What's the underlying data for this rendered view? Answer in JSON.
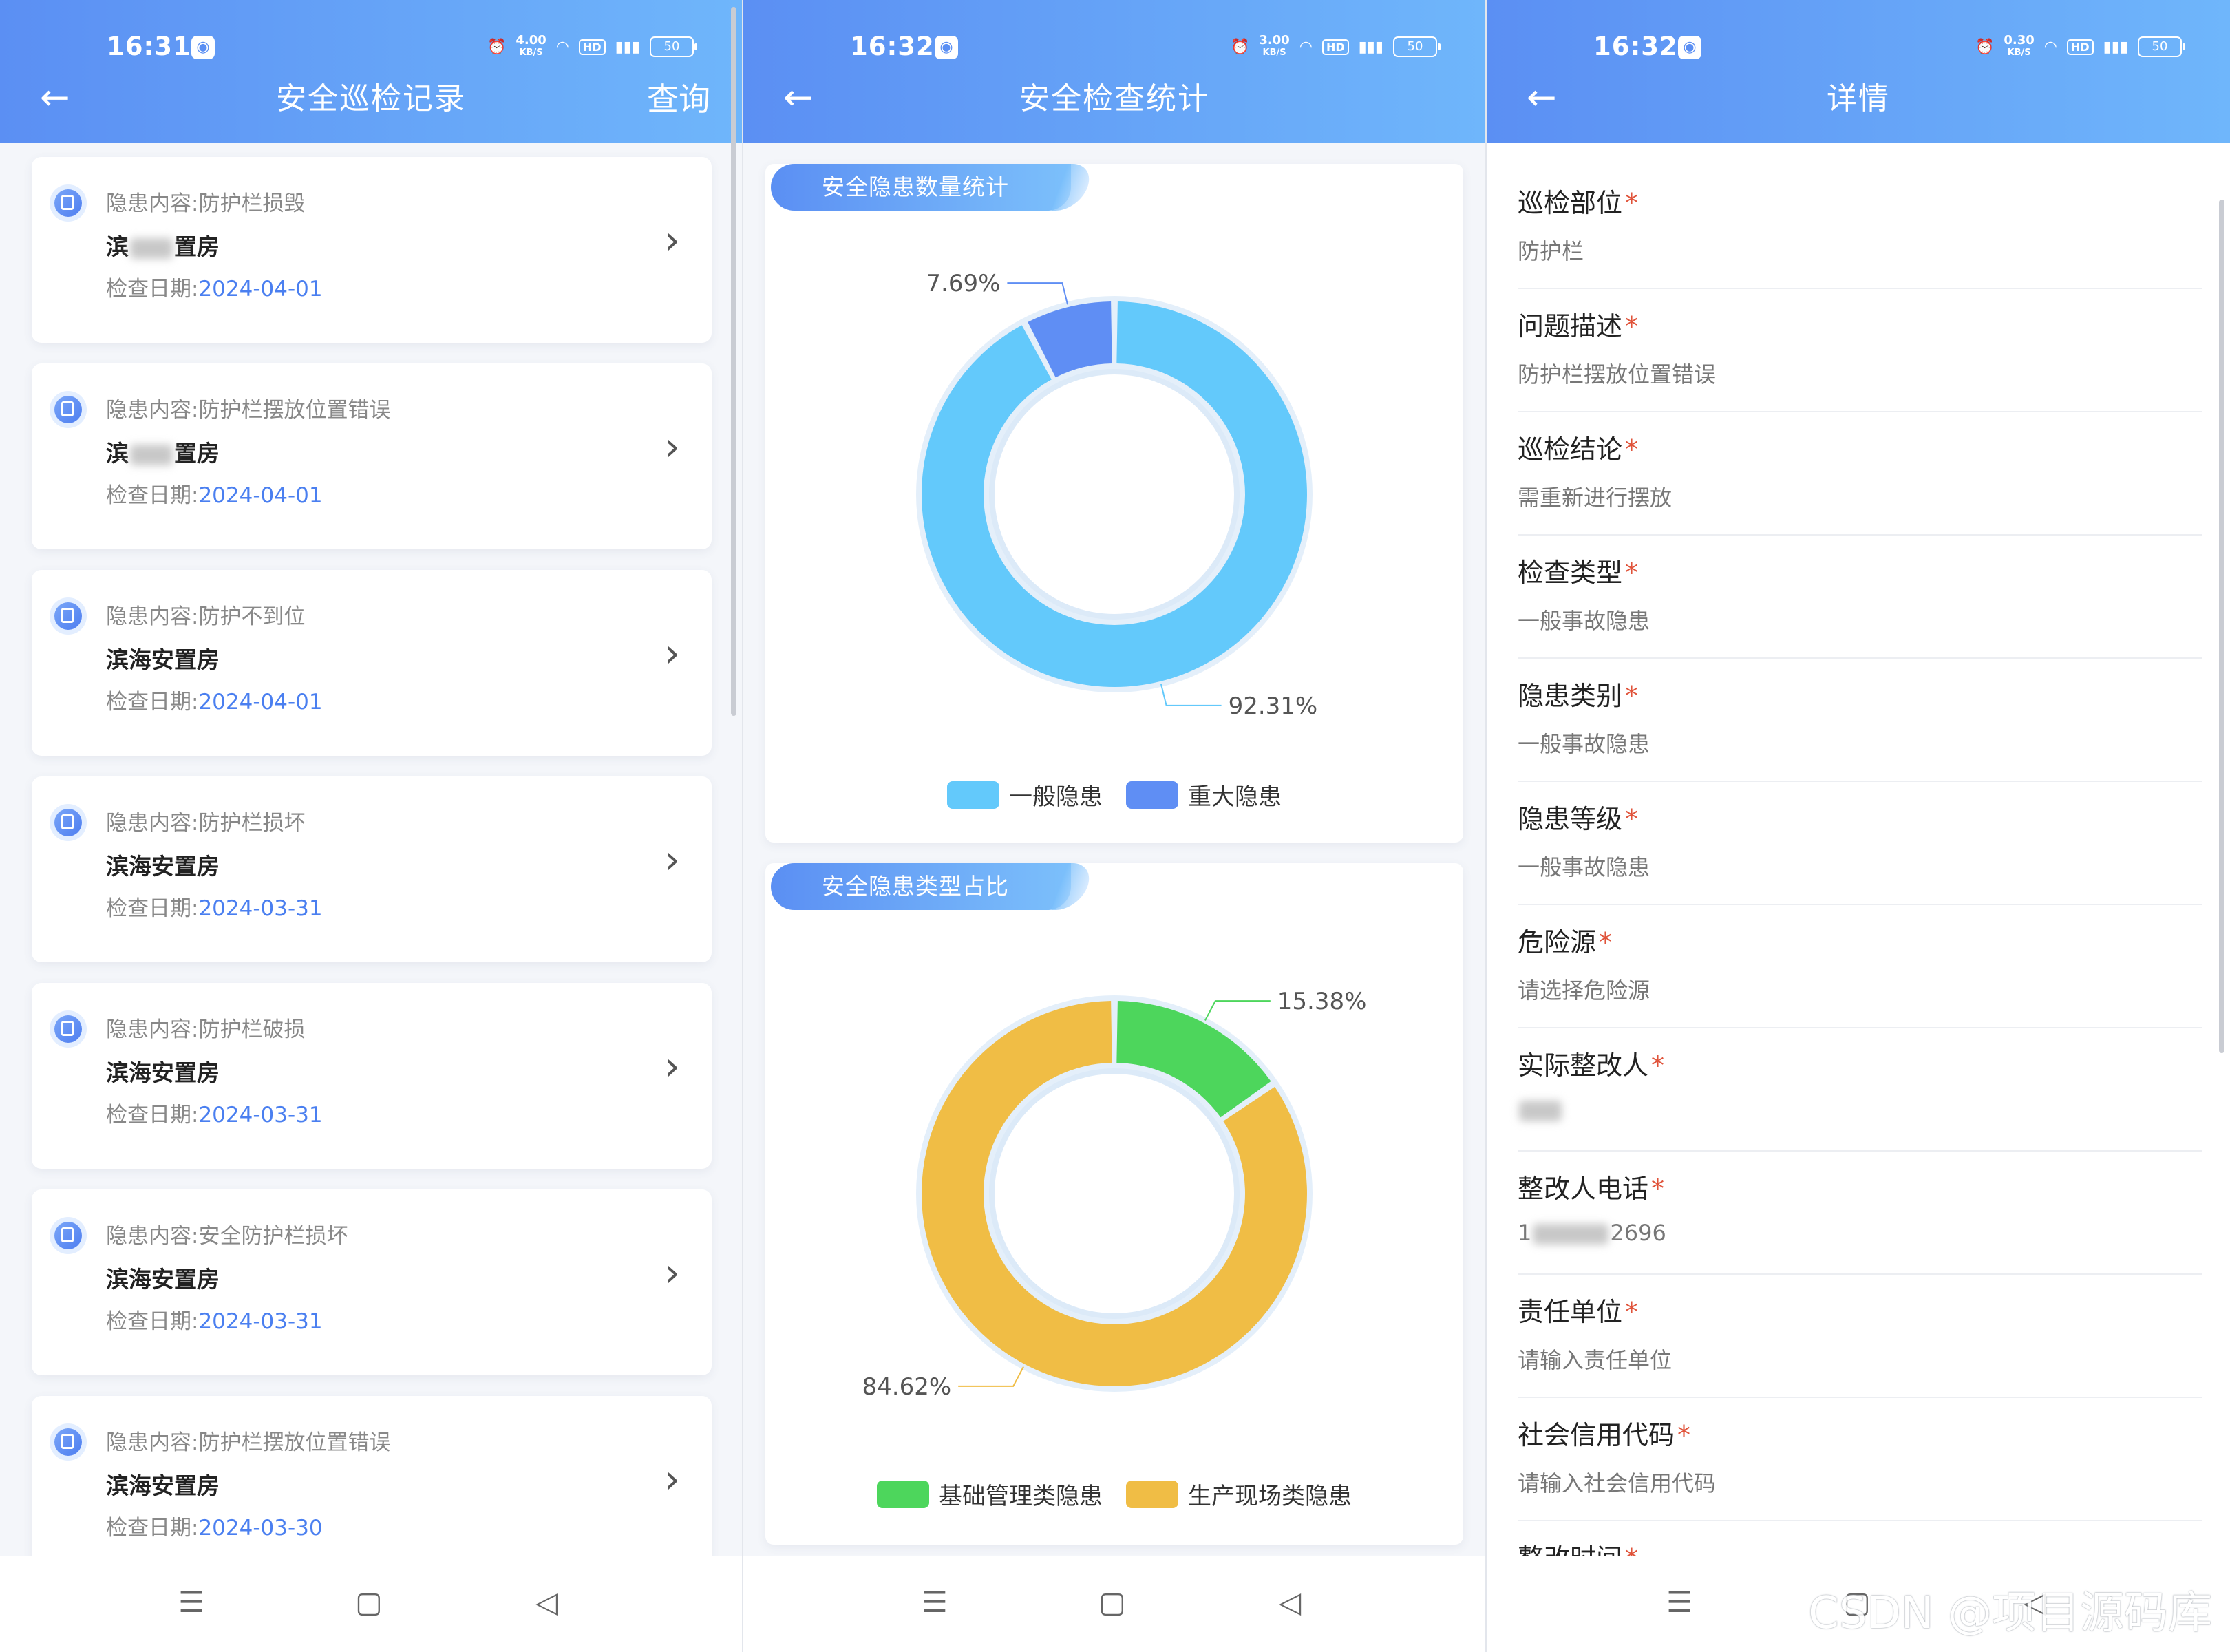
{
  "records": {
    "status_time": "16:31",
    "speed": "4.00",
    "speed_unit": "KB/S",
    "battery": "50",
    "title": "安全巡检记录",
    "action": "查询",
    "date_prefix": "检查日期:",
    "items": [
      {
        "content": "隐患内容:防护栏损毁",
        "place_a": "滨",
        "place_b": "置房",
        "place_blurred": true,
        "date": "2024-04-01"
      },
      {
        "content": "隐患内容:防护栏摆放位置错误",
        "place_a": "滨",
        "place_b": "置房",
        "place_blurred": true,
        "date": "2024-04-01"
      },
      {
        "content": "隐患内容:防护不到位",
        "place_a": "滨海安置房",
        "place_b": "",
        "date": "2024-04-01"
      },
      {
        "content": "隐患内容:防护栏损坏",
        "place_a": "滨海安置房",
        "place_b": "",
        "date": "2024-03-31"
      },
      {
        "content": "隐患内容:防护栏破损",
        "place_a": "滨海安置房",
        "place_b": "",
        "date": "2024-03-31"
      },
      {
        "content": "隐患内容:安全防护栏损坏",
        "place_a": "滨海安置房",
        "place_b": "",
        "date": "2024-03-31"
      },
      {
        "content": "隐患内容:防护栏摆放位置错误",
        "place_a": "滨海安置房",
        "place_b": "",
        "date": "2024-03-30"
      }
    ]
  },
  "stats": {
    "status_time": "16:32",
    "speed": "3.00",
    "speed_unit": "KB/S",
    "battery": "50",
    "title": "安全检查统计",
    "card1_title": "安全隐患数量统计",
    "card2_title": "安全隐患类型占比"
  },
  "chart_data": [
    {
      "type": "pie",
      "variant": "donut",
      "title": "安全隐患数量统计",
      "categories": [
        "一般隐患",
        "重大隐患"
      ],
      "values": [
        92.31,
        7.69
      ],
      "labels": [
        "92.31%",
        "7.69%"
      ],
      "colors": [
        "#63c9fb",
        "#5f8ef4"
      ],
      "legend": "bottom"
    },
    {
      "type": "pie",
      "variant": "donut",
      "title": "安全隐患类型占比",
      "categories": [
        "基础管理类隐患",
        "生产现场类隐患"
      ],
      "values": [
        15.38,
        84.62
      ],
      "labels": [
        "15.38%",
        "84.62%"
      ],
      "colors": [
        "#4dd65c",
        "#f0bd45"
      ],
      "legend": "bottom"
    }
  ],
  "detail": {
    "status_time": "16:32",
    "speed": "0.30",
    "speed_unit": "KB/S",
    "battery": "50",
    "title": "详情",
    "fields": [
      {
        "label": "巡检部位",
        "value": "防护栏"
      },
      {
        "label": "问题描述",
        "value": "防护栏摆放位置错误"
      },
      {
        "label": "巡检结论",
        "value": "需重新进行摆放"
      },
      {
        "label": "检查类型",
        "value": "一般事故隐患"
      },
      {
        "label": "隐患类别",
        "value": "一般事故隐患"
      },
      {
        "label": "隐患等级",
        "value": "一般事故隐患"
      },
      {
        "label": "危险源",
        "value": "请选择危险源"
      },
      {
        "label": "实际整改人",
        "value": "",
        "blurred": true
      },
      {
        "label": "整改人电话",
        "value_a": "1",
        "value_b": "2696",
        "blurred": true
      },
      {
        "label": "责任单位",
        "value": "请输入责任单位"
      },
      {
        "label": "社会信用代码",
        "value": "请输入社会信用代码"
      },
      {
        "label": "整改时间",
        "value": ""
      }
    ],
    "watermark": "CSDN @项目源码库"
  },
  "colors": {
    "header_start": "#5b8ff3",
    "header_end": "#6fb6fb",
    "accent": "#4a7ff0",
    "required": "#e0533a"
  }
}
